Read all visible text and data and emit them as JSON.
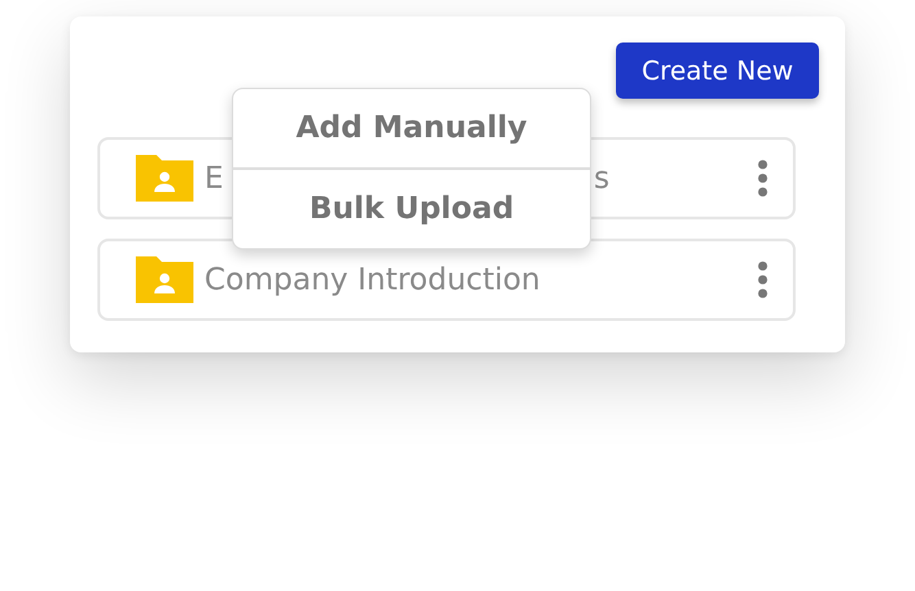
{
  "header": {
    "create_button": "Create New"
  },
  "folders": [
    {
      "label_parts": [
        "E",
        "s"
      ]
    },
    {
      "label_parts": [
        "Company Introduction"
      ]
    }
  ],
  "menu": {
    "items": [
      "Add Manually",
      "Bulk Upload"
    ]
  }
}
